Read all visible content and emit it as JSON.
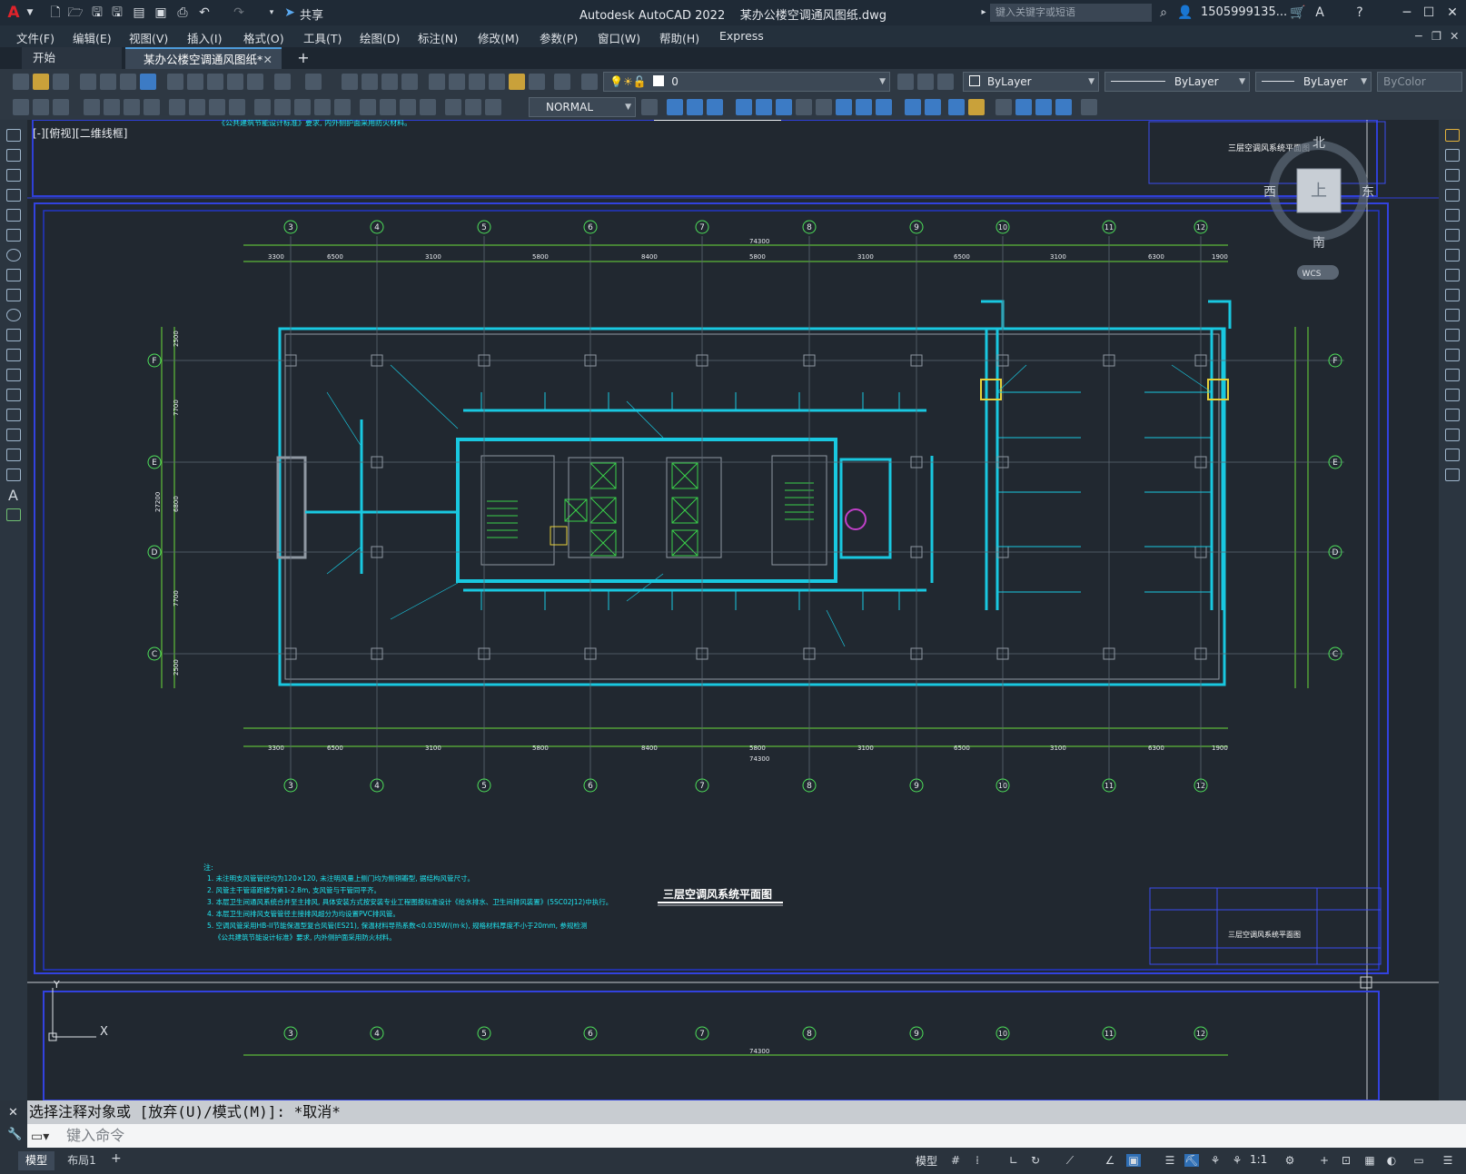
{
  "app": {
    "logo": "A",
    "title": "Autodesk AutoCAD 2022",
    "file_name": "某办公楼空调通风图纸.dwg",
    "share_label": "共享",
    "search_placeholder": "键入关键字或短语",
    "user": "1505999135...",
    "help": "?"
  },
  "menu": [
    "文件(F)",
    "编辑(E)",
    "视图(V)",
    "插入(I)",
    "格式(O)",
    "工具(T)",
    "绘图(D)",
    "标注(N)",
    "修改(M)",
    "参数(P)",
    "窗口(W)",
    "帮助(H)",
    "Express"
  ],
  "tabs": [
    {
      "label": "开始",
      "active": false
    },
    {
      "label": "某办公楼空调通风图纸*",
      "active": true
    }
  ],
  "toolbar": {
    "layer_value": "0",
    "color_value": "ByLayer",
    "linetype_value": "ByLayer",
    "lineweight_value": "ByLayer",
    "plotstyle_value": "ByColor",
    "dimstyle_value": "NORMAL"
  },
  "viewport": {
    "view_label": "[-][俯视][二维线框]",
    "viewcube": {
      "north": "北",
      "south": "南",
      "east": "东",
      "west": "西",
      "top": "上",
      "wcs": "WCS"
    }
  },
  "drawing": {
    "title": "三层空调风系统平面图",
    "title_block_name": "三层空调风系统平面图",
    "axes_top": [
      "3",
      "4",
      "5",
      "6",
      "7",
      "8",
      "9",
      "10",
      "11",
      "12"
    ],
    "axes_side": [
      "F",
      "E",
      "D",
      "C"
    ],
    "dims_top": [
      "3300",
      "6500",
      "3100",
      "5800",
      "8400",
      "5800",
      "3100",
      "6500",
      "3100",
      "6300",
      "1900"
    ],
    "dims_total": "74300",
    "dims_left": [
      "2500",
      "7700",
      "6800",
      "7700",
      "2500"
    ],
    "dims_left_total": "27200",
    "notes_title": "注:",
    "notes": [
      "1. 未注明支风管管径均为120×120, 未注明风量上侧门均为侧铜瓣型, 据结构风管尺寸。",
      "2. 风管主干管道距楼为第1-2.8m, 支风管与干管同平齐。",
      "3. 本层卫生间通风系统合并至主排风, 具体安装方式按安装专业工程图按标准设计《给水排水、卫生间排风装置》(5SC02J12)中执行。",
      "4. 本层卫生间排风支管管径主接排风超分为均设置PVC排风管。",
      "5. 空调风管采用HB-II节能保温型复合风管(ES21), 保温材料导热系数<0.035W/(m·k), 规格材料厚度不小于20mm, 参规检测",
      "《公共建筑节能设计标准》要求, 内外侧护面采用防火材料。"
    ],
    "header_note": "《公共建筑节能设计标准》要求, 内外侧护面采用防火材料。"
  },
  "command": {
    "history": "选择注释对象或 [放弃(U)/模式(M)]: *取消*",
    "placeholder": "键入命令"
  },
  "status": {
    "layout_tabs": [
      "模型",
      "布局1"
    ],
    "model_label": "模型",
    "scale": "1:1"
  }
}
